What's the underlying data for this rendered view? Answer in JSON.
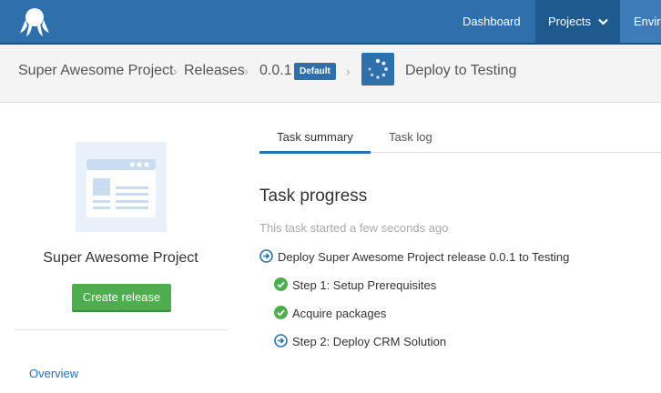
{
  "nav": {
    "items": [
      {
        "label": "Dashboard"
      },
      {
        "label": "Projects"
      },
      {
        "label": "Envir"
      }
    ]
  },
  "breadcrumb": {
    "project": "Super Awesome Project",
    "releases": "Releases",
    "version": "0.0.1",
    "badge": "Default",
    "task": "Deploy to Testing",
    "separator": "›"
  },
  "sidebar": {
    "project_name": "Super Awesome Project",
    "create_button": "Create release",
    "overview_link": "Overview"
  },
  "tabs": [
    {
      "label": "Task summary",
      "active": true
    },
    {
      "label": "Task log",
      "active": false
    }
  ],
  "task": {
    "title": "Task progress",
    "subtitle": "This task started a few seconds ago",
    "steps": [
      {
        "label": "Deploy Super Awesome Project release 0.0.1 to Testing",
        "status": "running",
        "icon": "arrow-circle-icon"
      },
      {
        "label": "Step 1: Setup Prerequisites",
        "status": "success",
        "icon": "check-circle-icon"
      },
      {
        "label": "Acquire packages",
        "status": "success",
        "icon": "check-circle-icon"
      },
      {
        "label": "Step 2: Deploy CRM Solution",
        "status": "running",
        "icon": "arrow-circle-icon"
      }
    ]
  },
  "colors": {
    "brand": "#2f6fab",
    "success": "#4cae4c"
  }
}
